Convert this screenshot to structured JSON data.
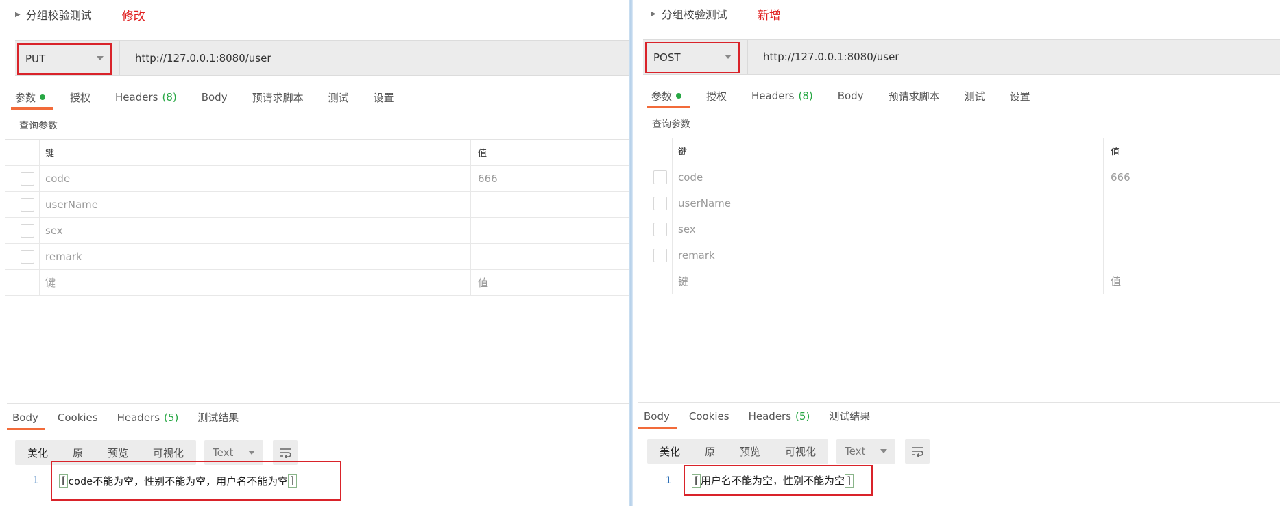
{
  "left": {
    "request_name": "分组校验测试",
    "tag": "修改",
    "method": "PUT",
    "url": "http://127.0.0.1:8080/user",
    "tabs": {
      "params": "参数",
      "auth": "授权",
      "headers": "Headers",
      "headers_count": "(8)",
      "body": "Body",
      "prescript": "预请求脚本",
      "tests": "测试",
      "settings": "设置"
    },
    "query_label": "查询参数",
    "table_head": {
      "key": "键",
      "value": "值"
    },
    "params": [
      {
        "key": "code",
        "value": "666"
      },
      {
        "key": "userName",
        "value": ""
      },
      {
        "key": "sex",
        "value": ""
      },
      {
        "key": "remark",
        "value": ""
      }
    ],
    "placeholder": {
      "key": "键",
      "value": "值"
    },
    "resp_tabs": {
      "body": "Body",
      "cookies": "Cookies",
      "headers": "Headers",
      "headers_count": "(5)",
      "results": "测试结果"
    },
    "view_modes": {
      "pretty": "美化",
      "raw": "原",
      "preview": "预览",
      "visualize": "可视化"
    },
    "format": "Text",
    "line_no": "1",
    "response_text": "code不能为空，性别不能为空，用户名不能为空"
  },
  "right": {
    "request_name": "分组校验测试",
    "tag": "新增",
    "method": "POST",
    "url": "http://127.0.0.1:8080/user",
    "tabs": {
      "params": "参数",
      "auth": "授权",
      "headers": "Headers",
      "headers_count": "(8)",
      "body": "Body",
      "prescript": "预请求脚本",
      "tests": "测试",
      "settings": "设置"
    },
    "query_label": "查询参数",
    "table_head": {
      "key": "键",
      "value": "值"
    },
    "params": [
      {
        "key": "code",
        "value": "666"
      },
      {
        "key": "userName",
        "value": ""
      },
      {
        "key": "sex",
        "value": ""
      },
      {
        "key": "remark",
        "value": ""
      }
    ],
    "placeholder": {
      "key": "键",
      "value": "值"
    },
    "resp_tabs": {
      "body": "Body",
      "cookies": "Cookies",
      "headers": "Headers",
      "headers_count": "(5)",
      "results": "测试结果"
    },
    "view_modes": {
      "pretty": "美化",
      "raw": "原",
      "preview": "预览",
      "visualize": "可视化"
    },
    "format": "Text",
    "line_no": "1",
    "response_text": "用户名不能为空，性别不能为空"
  },
  "colors": {
    "highlight_border": "#d9232a",
    "tab_underline": "#f26b3a",
    "status_green": "#27a744",
    "tag_red": "#e02020"
  }
}
